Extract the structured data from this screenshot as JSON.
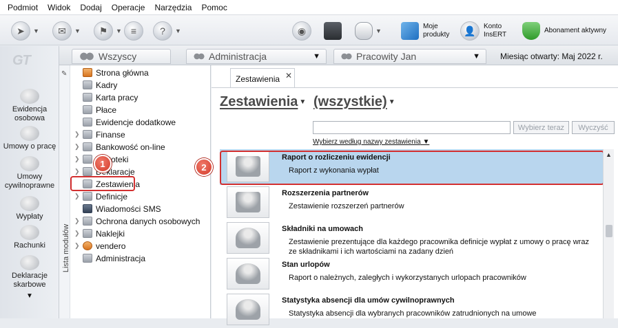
{
  "menu": [
    "Podmiot",
    "Widok",
    "Dodaj",
    "Operacje",
    "Narzędzia",
    "Pomoc"
  ],
  "toolbar": {
    "moje_programy": [
      "Moje",
      "produkty"
    ],
    "konto": [
      "Konto",
      "InsERT"
    ],
    "abonament": "Abonament aktywny"
  },
  "rail": {
    "logo": "GT",
    "items": [
      "Ewidencja osobowa",
      "Umowy o pracę",
      "Umowy cywilnoprawne",
      "Wypłaty",
      "Rachunki",
      "Deklaracje skarbowe"
    ]
  },
  "tabs": {
    "wszyscy": "Wszyscy",
    "administracja": "Administracja",
    "pracowity": "Pracowity Jan",
    "month_label": "Miesiąc otwarty:  Maj 2022 r."
  },
  "modules": {
    "side_label": "Lista modułów",
    "items": [
      "Strona główna",
      "Kadry",
      "Karta pracy",
      "Płace",
      "Ewidencje dodatkowe",
      "Finanse",
      "Bankowość on-line",
      "Kartoteki",
      "Deklaracje",
      "Zestawienia",
      "Definicje",
      "Wiadomości SMS",
      "Ochrona danych osobowych",
      "Naklejki",
      "vendero",
      "Administracja"
    ]
  },
  "markers": [
    "1",
    "2"
  ],
  "content": {
    "tab_label": "Zestawienia",
    "heading": "Zestawienia",
    "heading_filter": "(wszystkie)",
    "search_placeholder": "",
    "btn_choose": "Wybierz teraz",
    "btn_clear": "Wyczyść",
    "choose_by_name": "Wybierz według nazwy zestawienia",
    "reports": [
      {
        "title": "Raport o rozliczeniu ewidencji",
        "desc": "Raport z wykonania wypłat"
      },
      {
        "title": "Rozszerzenia partnerów",
        "desc": "Zestawienie rozszerzeń partnerów"
      },
      {
        "title": "Składniki na umowach",
        "desc": "Zestawienie prezentujące dla każdego pracownika definicje wypłat z umowy o pracę wraz ze składnikami i ich wartościami na zadany dzień"
      },
      {
        "title": "Stan urlopów",
        "desc": "Raport o należnych, zaległych i wykorzystanych urlopach pracowników"
      },
      {
        "title": "Statystyka absencji dla umów cywilnoprawnych",
        "desc": "Statystyka absencji dla wybranych pracowników zatrudnionych na umowe"
      }
    ]
  },
  "colors": {
    "selection": "#b9d6ee",
    "highlight": "#d32f2f"
  }
}
